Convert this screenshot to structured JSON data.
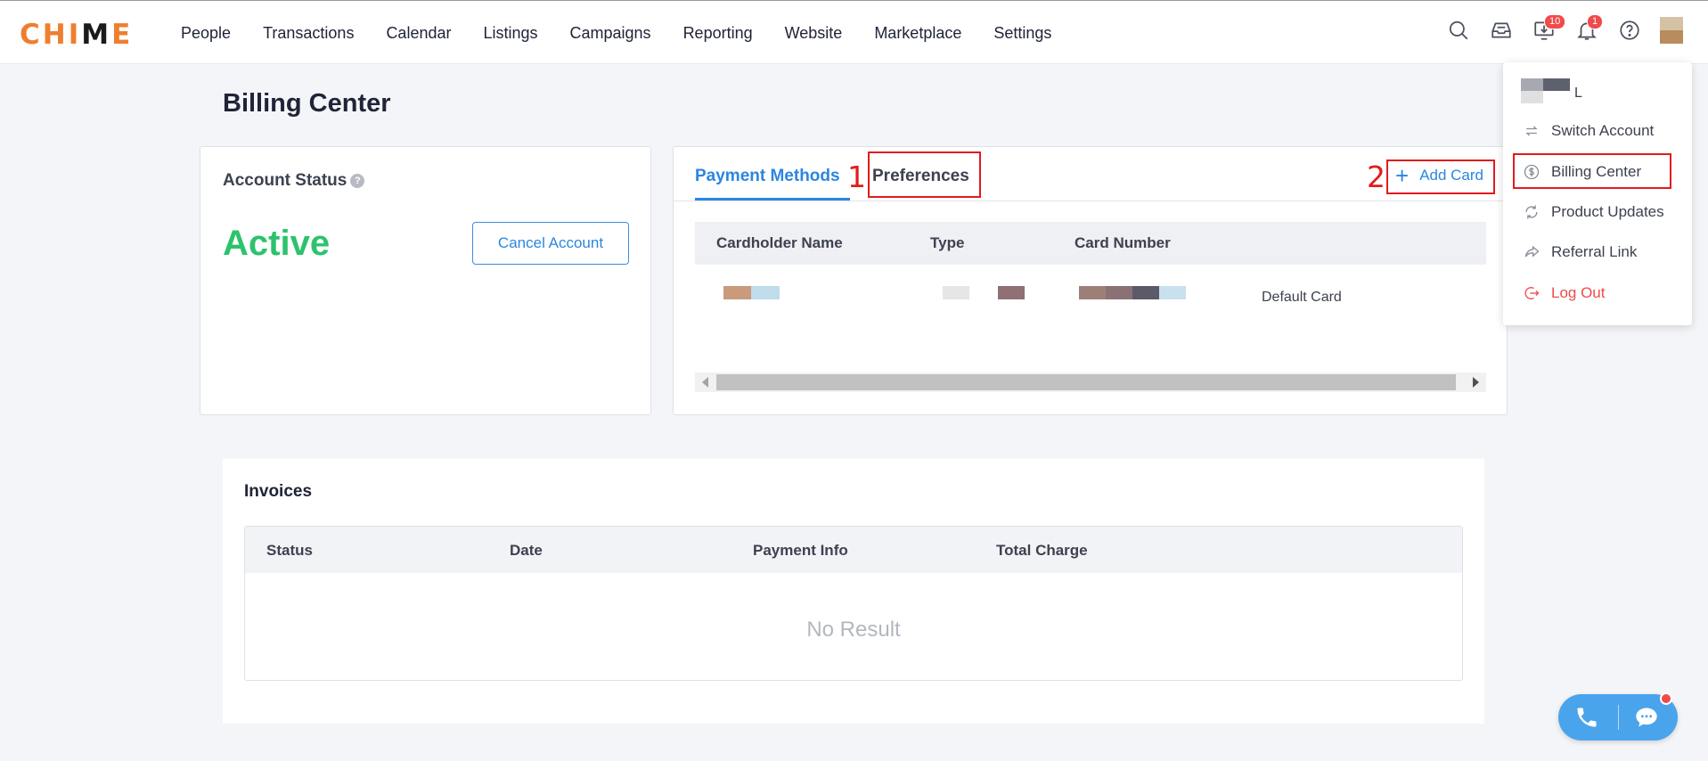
{
  "logo": {
    "text_a": "CHI",
    "text_b": "M",
    "text_c": "E"
  },
  "nav": {
    "items": [
      "People",
      "Transactions",
      "Calendar",
      "Listings",
      "Campaigns",
      "Reporting",
      "Website",
      "Marketplace",
      "Settings"
    ],
    "icons": [
      "search-icon",
      "inbox-icon",
      "download-monitor-icon",
      "bell-icon",
      "help-icon"
    ],
    "badges": {
      "downloads": "10",
      "notifications": "1"
    }
  },
  "page": {
    "title": "Billing Center"
  },
  "account_status": {
    "label": "Account Status",
    "help": "?",
    "value": "Active",
    "cancel_label": "Cancel Account"
  },
  "payment": {
    "tabs": [
      {
        "label": "Payment Methods",
        "active": true
      },
      {
        "label": "Preferences",
        "active": false
      }
    ],
    "add_card_label": "Add Card",
    "add_card_plus": "+",
    "columns": [
      "Cardholder Name",
      "Type",
      "Card Number"
    ],
    "row": {
      "default_label": "Default Card"
    }
  },
  "annotations": {
    "one": "1",
    "two": "2"
  },
  "invoices": {
    "title": "Invoices",
    "columns": [
      "Status",
      "Date",
      "Payment Info",
      "Total Charge"
    ],
    "empty_text": "No Result"
  },
  "dropdown": {
    "user_initial": "L",
    "items": [
      {
        "label": "Switch Account",
        "icon": "switch-icon"
      },
      {
        "label": "Billing Center",
        "icon": "dollar-circle-icon"
      },
      {
        "label": "Product Updates",
        "icon": "refresh-icon"
      },
      {
        "label": "Referral Link",
        "icon": "share-icon"
      },
      {
        "label": "Log Out",
        "icon": "logout-icon"
      }
    ]
  },
  "colors": {
    "brand": "#ef7e2f",
    "accent": "#2b86e0",
    "active": "#2cc36c",
    "danger": "#f04a4a",
    "annotation": "#e21b1b"
  }
}
